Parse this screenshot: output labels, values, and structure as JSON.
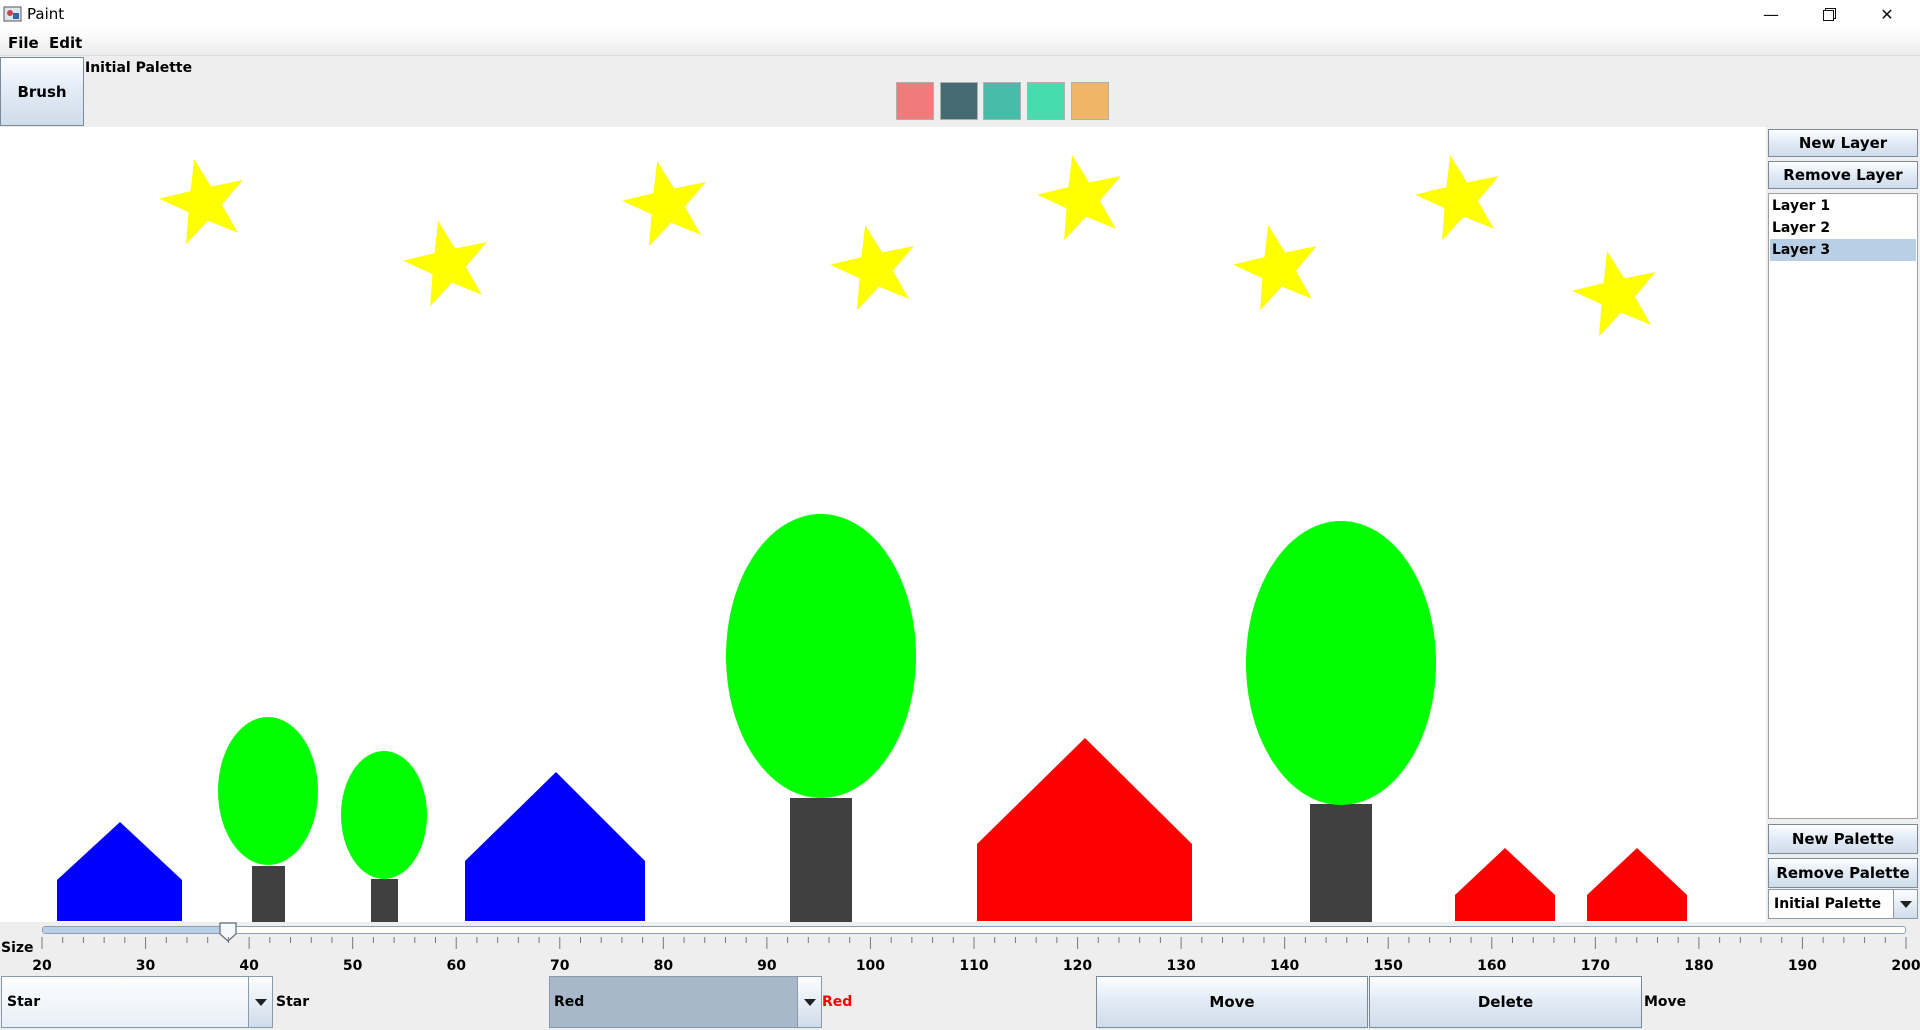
{
  "window": {
    "title": "Paint",
    "icons": {
      "app": "paint-app-icon",
      "minimize": "minimize-icon",
      "maximize": "restore-icon",
      "close": "close-icon"
    }
  },
  "menu": {
    "file": "File",
    "edit": "Edit"
  },
  "toolbar": {
    "brush_label": "Brush",
    "palette_name": "Initial Palette",
    "swatches": [
      "#f07b7b",
      "#456b72",
      "#47bca9",
      "#47dcae",
      "#efb66a"
    ]
  },
  "right_panel": {
    "new_layer": "New Layer",
    "remove_layer": "Remove Layer",
    "layers": [
      "Layer 1",
      "Layer 2",
      "Layer 3"
    ],
    "selected_layer": "Layer 3",
    "new_palette": "New Palette",
    "remove_palette": "Remove Palette",
    "palette_selected": "Initial Palette"
  },
  "slider": {
    "label": "Size",
    "min": 20,
    "max": 200,
    "value": 38,
    "ticks": [
      "20",
      "30",
      "40",
      "50",
      "60",
      "70",
      "80",
      "90",
      "100",
      "110",
      "120",
      "130",
      "140",
      "150",
      "160",
      "170",
      "180",
      "190",
      "200"
    ]
  },
  "bottom": {
    "shape_selected": "Star",
    "shape_current": "Star",
    "color_selected": "Red",
    "color_current": "Red",
    "move_label": "Move",
    "delete_label": "Delete",
    "mode_label": "Move"
  },
  "colors": {
    "star": "#ffff00",
    "tree_foliage": "#00ff00",
    "tree_trunk": "#404040",
    "house_blue": "#0000ff",
    "house_red": "#ff0000",
    "selection": "#b8cfe5"
  }
}
